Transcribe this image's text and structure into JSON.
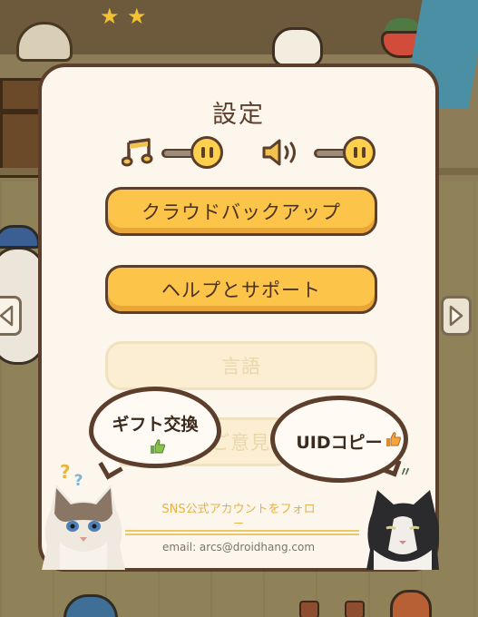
{
  "settings": {
    "title": "設定",
    "music_icon": "music-note-icon",
    "sound_icon": "speaker-icon",
    "music_level": 1.0,
    "sound_level": 1.0
  },
  "buttons": {
    "cloud_backup": "クラウドバックアップ",
    "help_support": "ヘルプとサポート",
    "language": "言語",
    "feedback": "ご意見"
  },
  "bubbles": {
    "gift_exchange": "ギフト交換",
    "uid_copy": "UIDコピー",
    "thumb_icon": "thumbs-up-icon"
  },
  "footer": {
    "sns_follow_line1": "SNS公式アカウントをフォロ",
    "sns_follow_line2": "ー",
    "email": "email: arcs@droidhang.com"
  },
  "colors": {
    "panel_bg": "#fdf6ec",
    "panel_border": "#5b3e2b",
    "button_yellow": "#fcc448",
    "disabled_button": "#fbeed2",
    "sns_link": "#e4b246"
  }
}
